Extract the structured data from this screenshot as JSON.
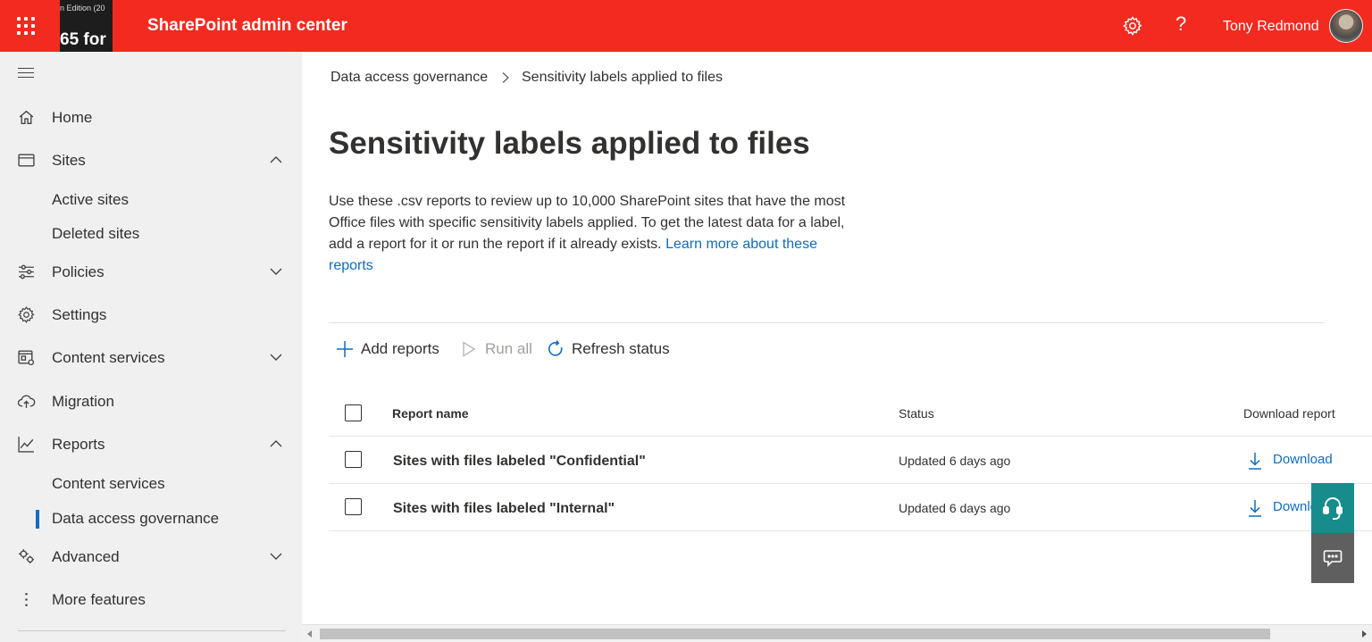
{
  "header": {
    "app_title": "SharePoint admin center",
    "thumbnail_text_top": "n Edition (20",
    "thumbnail_text_bottom": "65 for",
    "user_name": "Tony Redmond",
    "help_glyph": "?",
    "bar_color": "#f32a1f"
  },
  "sidebar": {
    "items": [
      {
        "label": "Home",
        "icon": "home-icon"
      },
      {
        "label": "Sites",
        "icon": "sites-icon",
        "expanded": true
      },
      {
        "label": "Active sites"
      },
      {
        "label": "Deleted sites"
      },
      {
        "label": "Policies",
        "icon": "policies-icon",
        "expanded": false
      },
      {
        "label": "Settings",
        "icon": "gear-icon"
      },
      {
        "label": "Content services",
        "icon": "content-services-icon",
        "expanded": false
      },
      {
        "label": "Migration",
        "icon": "cloud-upload-icon"
      },
      {
        "label": "Reports",
        "icon": "chart-icon",
        "expanded": true
      },
      {
        "label": "Content services"
      },
      {
        "label": "Data access governance",
        "active": true
      },
      {
        "label": "Advanced",
        "icon": "advanced-gears-icon",
        "expanded": false
      },
      {
        "label": "More features",
        "icon": "more-vertical-icon"
      }
    ]
  },
  "breadcrumb": {
    "parent": "Data access governance",
    "current": "Sensitivity labels applied to files"
  },
  "page": {
    "title": "Sensitivity labels applied to files",
    "description": "Use these .csv reports to review up to 10,000 SharePoint sites that have the most Office files with specific sensitivity labels applied. To get the latest data for a label, add a report for it or run the report if it already exists.",
    "learn_more": "Learn more about these reports"
  },
  "toolbar": {
    "add_reports": "Add reports",
    "run_all": "Run all",
    "refresh_status": "Refresh status"
  },
  "table": {
    "columns": {
      "name": "Report name",
      "status": "Status",
      "download": "Download report"
    },
    "rows": [
      {
        "name": "Sites with files labeled \"Confidential\"",
        "status": "Updated 6 days ago",
        "download": "Download"
      },
      {
        "name": "Sites with files labeled \"Internal\"",
        "status": "Updated 6 days ago",
        "download": "Download"
      }
    ]
  },
  "colors": {
    "accent": "#0f6cbd",
    "help_button": "#168c8c",
    "feedback_button": "#5f5f5f"
  }
}
